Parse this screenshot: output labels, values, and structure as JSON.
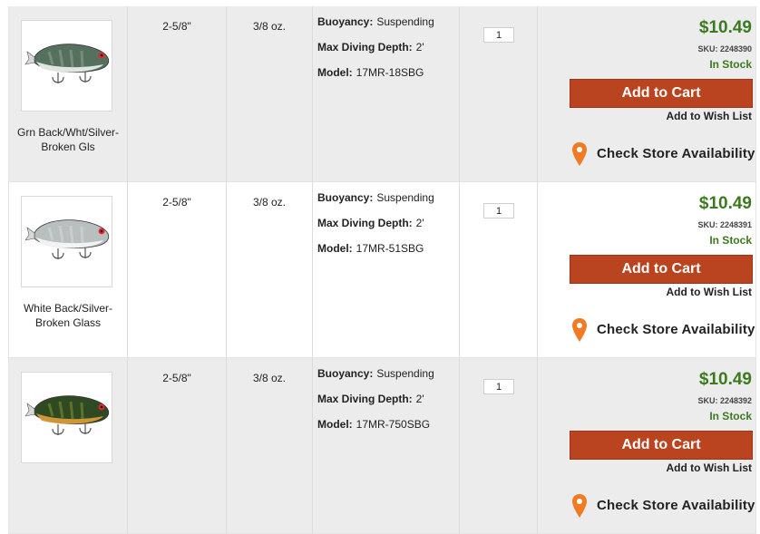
{
  "rows": [
    {
      "shade": "shaded",
      "image_alt": "lure-green-back",
      "image_label": "Grn Back/Wht/Silver-Broken Gls",
      "length": "2-5/8\"",
      "weight": "3/8 oz.",
      "buoyancy_label": "Buoyancy:",
      "buoyancy": "Suspending",
      "depth_label": "Max Diving Depth:",
      "depth": "2'",
      "model_label": "Model:",
      "model": "17MR-18SBG",
      "qty": "1",
      "price": "$10.49",
      "sku": "SKU: 2248390",
      "stock": "In Stock",
      "cart": "Add to Cart",
      "wish": "Add to Wish List",
      "store": "Check Store Availability",
      "colors": {
        "back": "#56705e",
        "belly": "#e6ece6",
        "stripe": "#8f9e92"
      }
    },
    {
      "shade": "white",
      "image_alt": "lure-white-back",
      "image_label": "White Back/Silver-Broken Glass",
      "length": "2-5/8\"",
      "weight": "3/8 oz.",
      "buoyancy_label": "Buoyancy:",
      "buoyancy": "Suspending",
      "depth_label": "Max Diving Depth:",
      "depth": "2'",
      "model_label": "Model:",
      "model": "17MR-51SBG",
      "qty": "1",
      "price": "$10.49",
      "sku": "SKU: 2248391",
      "stock": "In Stock",
      "cart": "Add to Cart",
      "wish": "Add to Wish List",
      "store": "Check Store Availability",
      "colors": {
        "back": "#b9bebe",
        "belly": "#f4f6f6",
        "stripe": "#d4d8d8"
      }
    },
    {
      "shade": "shaded",
      "image_alt": "lure-perch",
      "image_label": "",
      "length": "2-5/8\"",
      "weight": "3/8 oz.",
      "buoyancy_label": "Buoyancy:",
      "buoyancy": "Suspending",
      "depth_label": "Max Diving Depth:",
      "depth": "2'",
      "model_label": "Model:",
      "model": "17MR-750SBG",
      "qty": "1",
      "price": "$10.49",
      "sku": "SKU: 2248392",
      "stock": "In Stock",
      "cart": "Add to Cart",
      "wish": "Add to Wish List",
      "store": "Check Store Availability",
      "colors": {
        "back": "#2f4a22",
        "belly": "#d89a3a",
        "stripe": "#7e8e2e"
      }
    }
  ],
  "theme": {
    "price_green": "#3c7a1f",
    "button_red": "#bb4420",
    "pin_orange": "#f07b23",
    "row_shade": "#ececec"
  },
  "icons": {
    "store_pin": "map-pin-icon"
  }
}
